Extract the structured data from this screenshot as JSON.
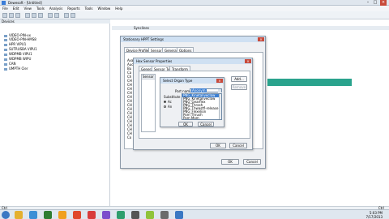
{
  "app": {
    "title": "Dewesoft - [Untitled]"
  },
  "menu": [
    "File",
    "Edit",
    "View",
    "Tools",
    "Analysis",
    "Reports",
    "Tools",
    "Window",
    "Help"
  ],
  "left_pane": {
    "header": "Devices",
    "items": [
      "VIDEO-PIN-xx",
      "VIDEO-PIN-HMS8",
      "HPR VIPU1",
      "SUTRUSBA VIPU1",
      "WDPMB VIPU1",
      "WDPMB WIPU",
      "CAN",
      "UMPTH Cler"
    ]
  },
  "right_pane": {
    "header": "Synclines"
  },
  "dlg_outer": {
    "title": "Stationary HPPT Settings",
    "tabs": [
      "Device Profiles",
      "Sensors",
      "General",
      "Options"
    ],
    "side_labels": [
      "Ava",
      "Auc",
      "Bu",
      "Ca",
      "Ch",
      "CH",
      "CH",
      "CH",
      "CH",
      "CH",
      "CH",
      "CH",
      "CH",
      "CH",
      "CH",
      "CH",
      "CH",
      "CH",
      "CH",
      "Co"
    ],
    "ok_label": "OK",
    "cancel_label": "Cancel"
  },
  "dlg_mid": {
    "title": "Hex Sensor Properties",
    "tabs": [
      "General",
      "Sensor Types",
      "Transform"
    ],
    "list_header": "Sensor Type",
    "add_label": "Add...",
    "remove_label": "Remove",
    "ok_label": "OK",
    "cancel_label": "Cancel"
  },
  "dlg_inner": {
    "title": "Select Organ Type",
    "field_label": "Part name:",
    "field_value": "Anonym",
    "left_labels": [
      "Substitute",
      "Ac",
      "An"
    ],
    "options": [
      "PNG_Kinetaliveclaw",
      "PNG_Kinetaliveclaw",
      "PNG_Gearflex",
      "PNG_Thrash",
      "PNG_Thwastfl-release",
      "PNG_Flexelion",
      "Pom Thrush",
      "Pom Mom",
      "Hom Mom-Averaged"
    ],
    "selected_index": 0,
    "ok_label": "OK",
    "cancel_label": "Cancel"
  },
  "status": {
    "text": "Ctrl",
    "clock_time": "5:03 PM",
    "clock_date": "7/17/2013"
  },
  "taskbar_colors": [
    "#3a78c3",
    "#e4b030",
    "#3c8fd6",
    "#2e7d32",
    "#f0a020",
    "#e0472c",
    "#d83c3c",
    "#7c4dcc",
    "#2e9e6e",
    "#555555",
    "#8fc33a",
    "#6b6b6b"
  ]
}
